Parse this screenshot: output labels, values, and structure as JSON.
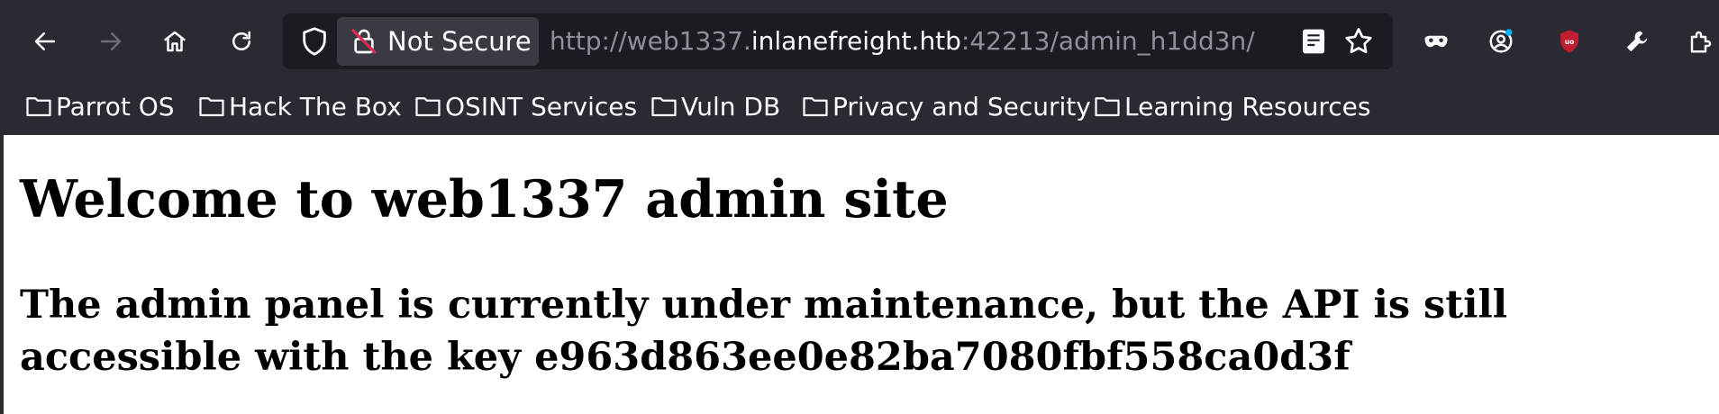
{
  "browser": {
    "security_label": "Not Secure",
    "url": {
      "prefix": "http://web1337.",
      "domain": "inlanefreight.htb",
      "suffix": ":42213/admin_h1dd3n/"
    },
    "icons": [
      "back-icon",
      "forward-icon",
      "home-icon",
      "reload-icon",
      "shield-icon",
      "lock-slash-icon",
      "reader-view-icon",
      "bookmark-star-icon",
      "private-mask-icon",
      "account-icon",
      "ublock-icon",
      "wrench-icon",
      "extensions-icon"
    ],
    "accent_colors": {
      "toolbar": "#2b2a33",
      "urlbar": "#1c1b22",
      "ublock": "#c01e2e",
      "notification_dot": "#00b3f4"
    }
  },
  "bookmarks": [
    {
      "label": "Parrot OS"
    },
    {
      "label": "Hack The Box"
    },
    {
      "label": "OSINT Services"
    },
    {
      "label": "Vuln DB"
    },
    {
      "label": "Privacy and Security"
    },
    {
      "label": "Learning Resources"
    }
  ],
  "page": {
    "heading": "Welcome to web1337 admin site",
    "subheading": "The admin panel is currently under maintenance, but the API is still accessible with the key e963d863ee0e82ba7080fbf558ca0d3f"
  }
}
